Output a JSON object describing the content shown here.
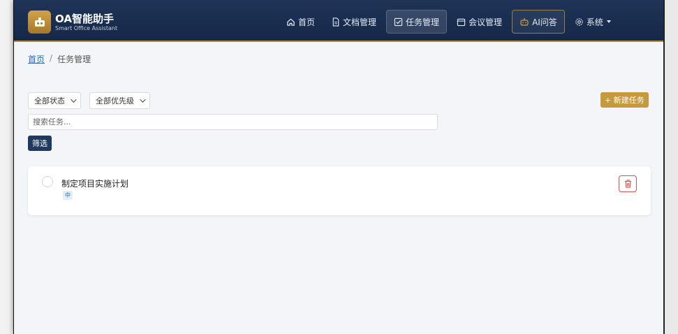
{
  "brand": {
    "title": "OA智能助手",
    "subtitle": "Smart Office Assistant"
  },
  "nav": {
    "items": [
      {
        "label": "首页",
        "icon": "home-icon"
      },
      {
        "label": "文档管理",
        "icon": "document-icon"
      },
      {
        "label": "任务管理",
        "icon": "checkbox-icon",
        "active": true
      },
      {
        "label": "会议管理",
        "icon": "calendar-icon"
      },
      {
        "label": "AI问答",
        "icon": "robot-icon"
      },
      {
        "label": "系统",
        "icon": "gear-icon",
        "dropdown": true
      }
    ]
  },
  "breadcrumb": {
    "home": "首页",
    "separator": "/",
    "current": "任务管理"
  },
  "filters": {
    "status_select": "全部状态",
    "priority_select": "全部优先级",
    "search_placeholder": "搜索任务...",
    "filter_button": "筛选"
  },
  "actions": {
    "new_task_button": "+ 新建任务"
  },
  "tasks": [
    {
      "title": "制定项目实施计划",
      "priority": "中",
      "completed": false
    }
  ],
  "colors": {
    "navbar": "#1f3457",
    "accent_gold": "#c49a3c",
    "primary_dark": "#1f3a5f",
    "danger": "#d9534f"
  }
}
